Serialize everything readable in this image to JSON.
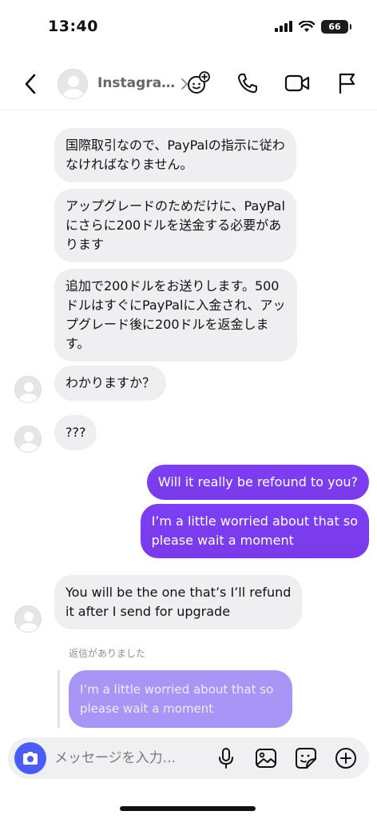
{
  "status_bar": {
    "time": "13:40",
    "battery": "66"
  },
  "header": {
    "name": "Instagra…"
  },
  "messages": [
    {
      "side": "in",
      "text": "国際取引なので、PayPalの指示に従わ\nなければなりません。"
    },
    {
      "side": "in",
      "text": "アップグレードのためだけに、PayPal\nにさらに200ドルを送金する必要があ\nります"
    },
    {
      "side": "in",
      "text": "追加で200ドルをお送りします。500\nドルはすぐにPayPalに入金され、アッ\nプグレード後に200ドルを返金しま\nす。"
    },
    {
      "side": "in",
      "text": "わかりますか？"
    },
    {
      "side": "in",
      "text": "???"
    },
    {
      "side": "out",
      "text": "Will it really be refound to you?"
    },
    {
      "side": "out",
      "text": "I’m a little worried about that so\nplease wait a moment"
    },
    {
      "side": "in",
      "text": "You will be the one that’s I’ll refund\nit after I send for upgrade"
    }
  ],
  "reply": {
    "label": "返信がありました",
    "quoted_text": "I’m a little worried about that so\nplease wait a moment"
  },
  "composer": {
    "placeholder": "メッセージを入力..."
  },
  "icons": {
    "header": [
      "back-icon",
      "add-face-icon",
      "phone-icon",
      "video-icon",
      "flag-icon"
    ],
    "composer": [
      "camera-icon",
      "microphone-icon",
      "image-icon",
      "sticker-icon",
      "plus-icon"
    ]
  },
  "colors": {
    "outgoing": "#7a3ae8",
    "incoming": "#efeff1",
    "camera": "#4a5df7",
    "reply_bubble": "#a896f7"
  }
}
